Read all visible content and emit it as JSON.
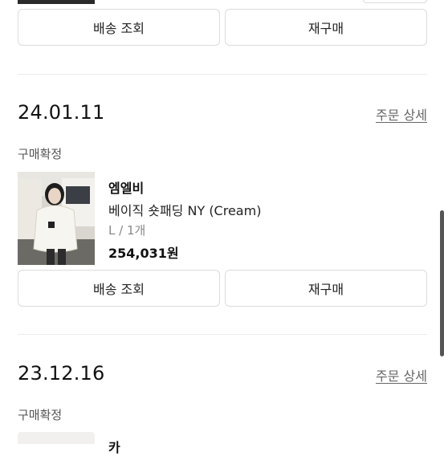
{
  "top_order": {
    "track_label": "배송 조회",
    "rebuy_label": "재구매"
  },
  "orders": [
    {
      "date": "24.01.11",
      "detail_link": "주문 상세",
      "status": "구매확정",
      "brand": "엠엘비",
      "product_name": "베이직 숏패딩 NY (Cream)",
      "option": "L / 1개",
      "price": "254,031원",
      "track_label": "배송 조회",
      "rebuy_label": "재구매"
    },
    {
      "date": "23.12.16",
      "detail_link": "주문 상세",
      "status": "구매확정",
      "brand_partial": "카"
    }
  ],
  "colors": {
    "divider": "#ececec",
    "button_border": "#dcdcdc",
    "status_text": "#555555",
    "option_text": "#888888"
  }
}
